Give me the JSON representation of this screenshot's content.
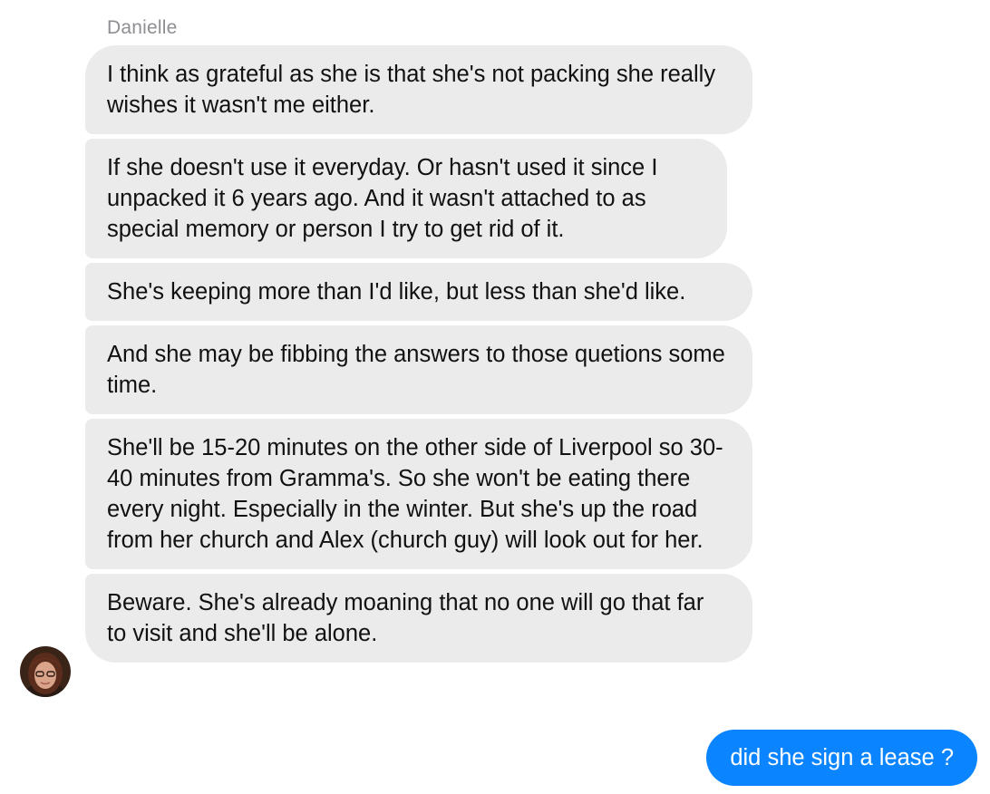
{
  "conversation": {
    "sender_name": "Danielle",
    "incoming_messages": [
      "I think as grateful as she is that she's not packing she really wishes it wasn't me either.",
      "If she doesn't use it everyday. Or hasn't used it since I unpacked it 6 years ago. And it wasn't attached to as special memory or person I try to get rid of it.",
      "She's keeping more than I'd like, but less than she'd like.",
      "And she may be fibbing the answers to those quetions some time.",
      "She'll be 15-20 minutes on the other side of Liverpool so 30-40 minutes from Gramma's. So she won't be eating there every night. Especially in the winter. But she's up the road from her church and Alex (church guy) will look out for her.",
      "Beware. She's already moaning that no one will go that far to visit and she'll be alone."
    ],
    "outgoing_message": "did she sign a lease ?"
  },
  "colors": {
    "incoming_bubble": "#ebebeb",
    "outgoing_bubble": "#0a84ff",
    "sender_name_text": "#8e8e93"
  }
}
